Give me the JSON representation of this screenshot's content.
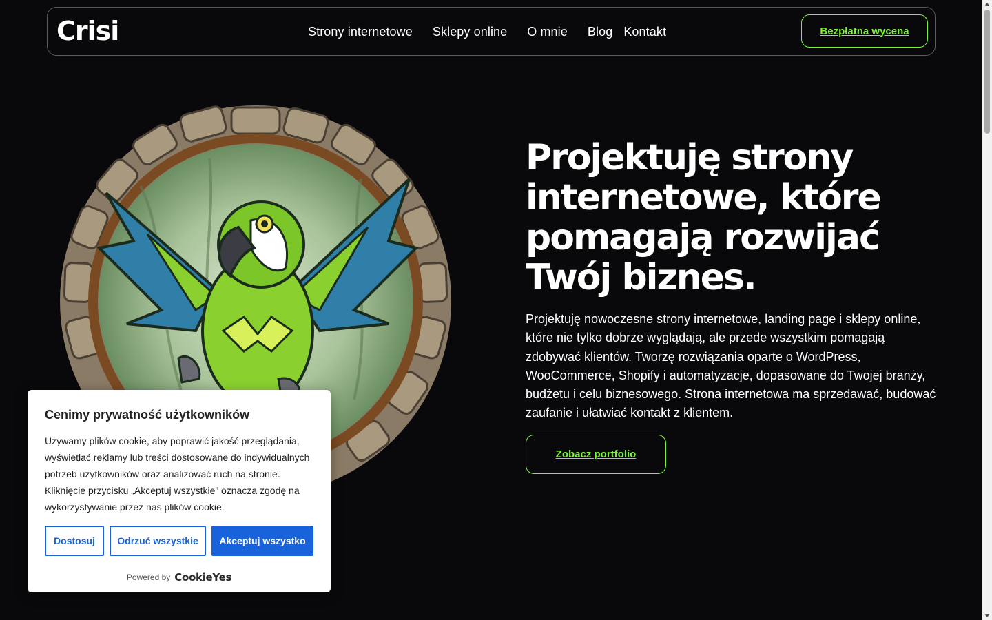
{
  "header": {
    "logo": "Crisi",
    "nav": [
      "Strony internetowe",
      "Sklepy online",
      "O mnie",
      "Blog",
      "Kontakt"
    ],
    "cta_label": "Bezpłatna wycena"
  },
  "hero": {
    "title": "Projektuję strony internetowe, które pomagają rozwijać Twój biznes.",
    "description": "Projektuję nowoczesne strony internetowe, landing page i sklepy online, które nie tylko dobrze wyglądają, ale przede wszystkim pomagają zdobywać klientów. Tworzę rozwiązania oparte o WordPress, WooCommerce, Shopify i automatyzacje, dopasowane do Twojej branży, budżetu i celu biznesowego. Strona internetowa ma sprzedawać, budować zaufanie i ułatwiać kontakt z klientem.",
    "portfolio_label": "Zobacz portfolio",
    "image_icon": "parrot-illustration"
  },
  "cookie_banner": {
    "title": "Cenimy prywatność użytkowników",
    "text": "Używamy plików cookie, aby poprawić jakość przeglądania, wyświetlać reklamy lub treści dostosowane do indywidualnych potrzeb użytkowników oraz analizować ruch na stronie. Kliknięcie przycisku „Akceptuj wszystkie” oznacza zgodę na wykorzystywanie przez nas plików cookie.",
    "customize_label": "Dostosuj",
    "reject_label": "Odrzuć wszystkie",
    "accept_label": "Akceptuj wszystko",
    "powered_by": "Powered by",
    "brand": "CookieYes"
  },
  "colors": {
    "background": "#09090b",
    "accent": "#7cf33a",
    "cookie_blue": "#1863dc"
  }
}
